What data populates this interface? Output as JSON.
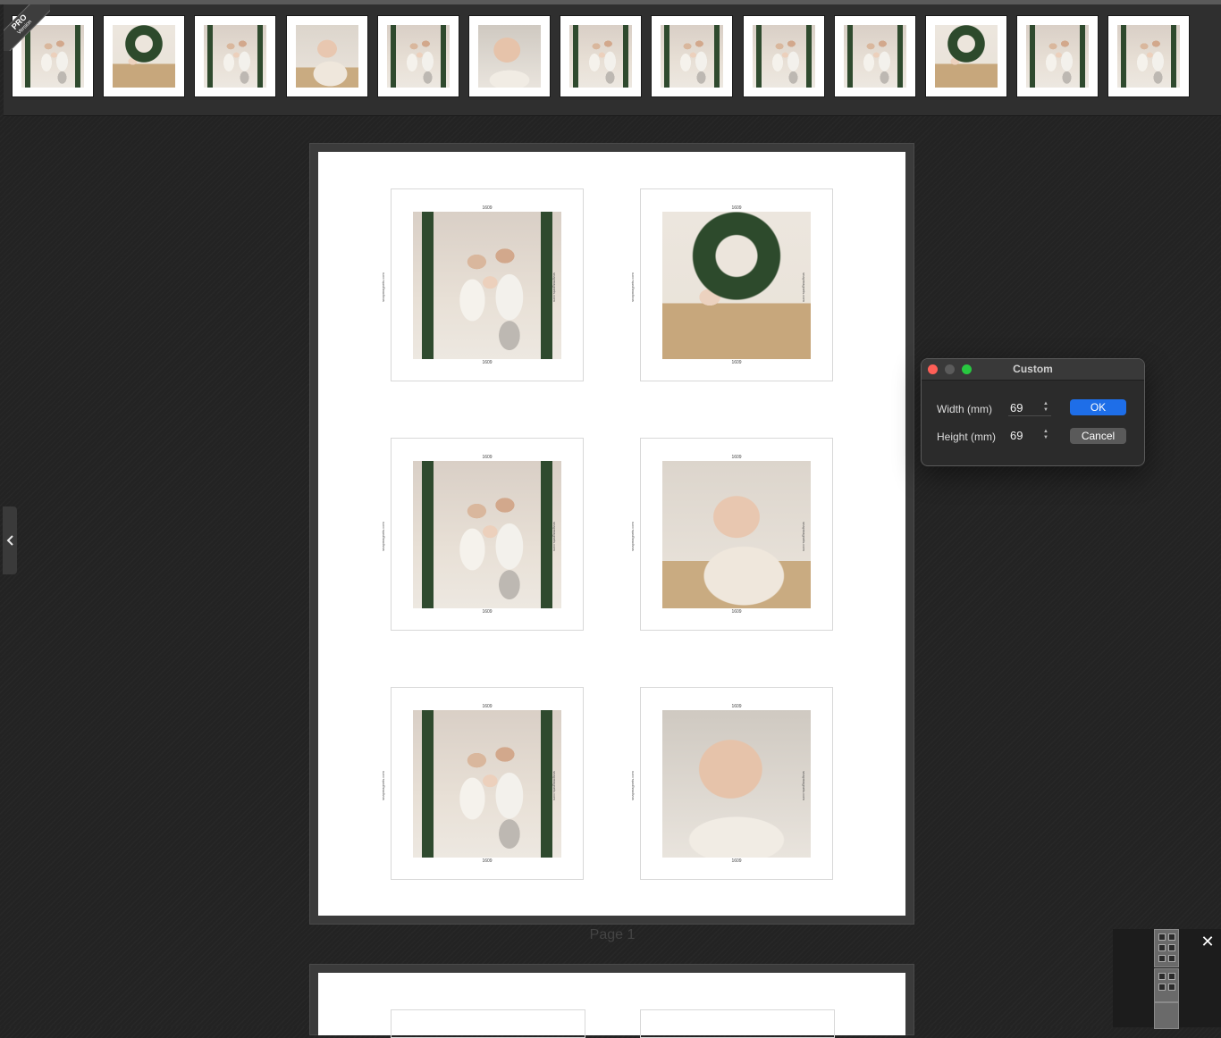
{
  "edition_badge": {
    "line1": "PRO",
    "line2": "Version"
  },
  "thumbnails": [
    {
      "name": "family-on-bench-thumbnail",
      "kind": "fam"
    },
    {
      "name": "baby-in-basket-wreath-thumbnail",
      "kind": "wreath"
    },
    {
      "name": "family-on-bench-thumbnail",
      "kind": "fam"
    },
    {
      "name": "baby-in-basket-thumbnail",
      "kind": "baby"
    },
    {
      "name": "family-on-bench-thumbnail",
      "kind": "fam"
    },
    {
      "name": "baby-closeup-thumbnail",
      "kind": "close"
    },
    {
      "name": "family-on-bench-thumbnail",
      "kind": "fam"
    },
    {
      "name": "couple-with-baby-thumbnail",
      "kind": "fam"
    },
    {
      "name": "father-with-baby-thumbnail",
      "kind": "fam"
    },
    {
      "name": "family-on-bench-thumbnail",
      "kind": "fam"
    },
    {
      "name": "wreath-thumbnail",
      "kind": "wreath"
    },
    {
      "name": "mother-with-baby-thumbnail",
      "kind": "fam"
    },
    {
      "name": "family-standing-thumbnail",
      "kind": "fam"
    }
  ],
  "page": {
    "label": "Page 1",
    "cards": [
      {
        "code": "1609",
        "side_text": "snapmagnets.com",
        "kind": "fam"
      },
      {
        "code": "1609",
        "side_text": "snapmagnets.com",
        "kind": "wreath"
      },
      {
        "code": "1609",
        "side_text": "snapmagnets.com",
        "kind": "fam"
      },
      {
        "code": "1609",
        "side_text": "snapmagnets.com",
        "kind": "baby"
      },
      {
        "code": "1609",
        "side_text": "snapmagnets.com",
        "kind": "fam"
      },
      {
        "code": "1609",
        "side_text": "snapmagnets.com",
        "kind": "close"
      }
    ]
  },
  "dialog": {
    "title": "Custom",
    "width_label": "Width (mm)",
    "width_value": "69",
    "height_label": "Height (mm)",
    "height_value": "69",
    "ok_label": "OK",
    "cancel_label": "Cancel",
    "colors": {
      "close": "#ff5f57",
      "minimize": "#5b5b5b",
      "zoom": "#28c840",
      "primary": "#1e6ee8"
    }
  },
  "minimap": {
    "close_label": "✕"
  }
}
